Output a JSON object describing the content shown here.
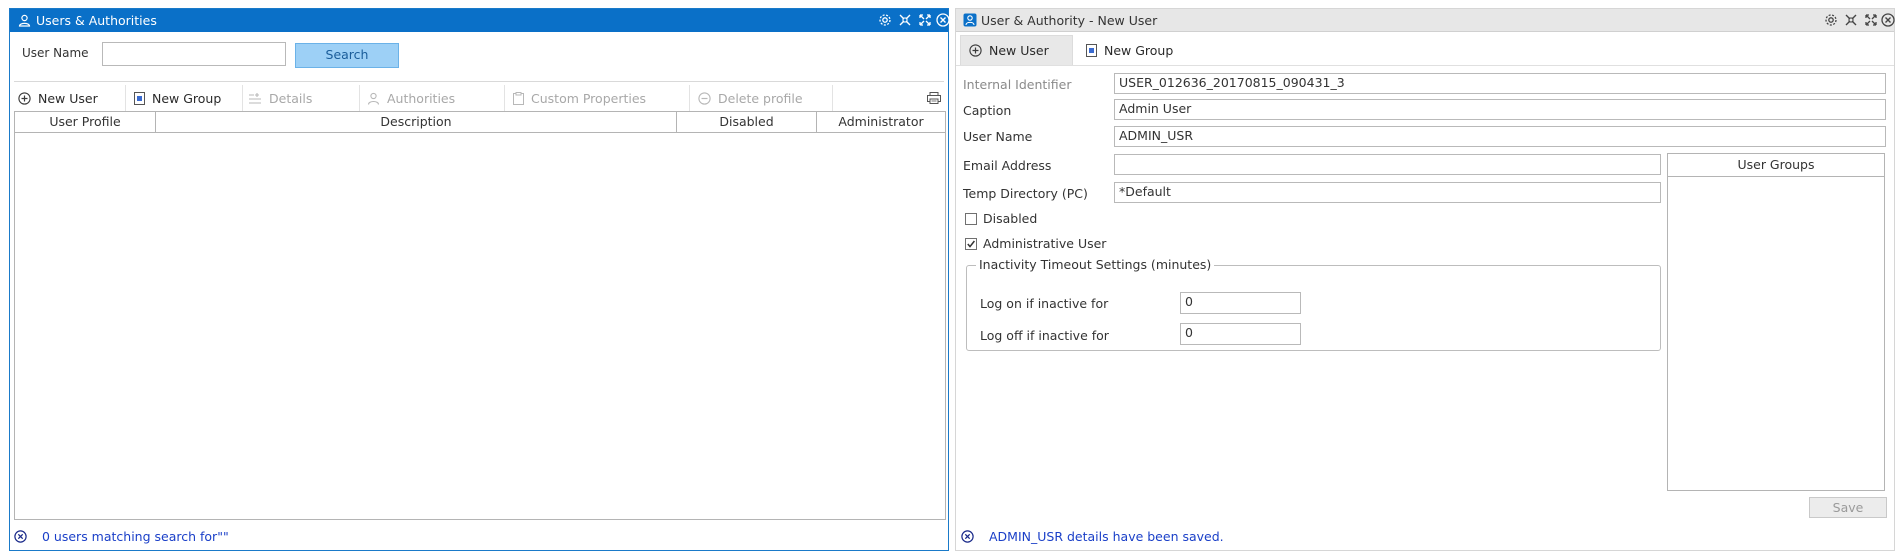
{
  "left_window": {
    "title": "Users & Authorities",
    "search": {
      "label": "User Name",
      "value": "",
      "button_label": "Search"
    },
    "toolbar": {
      "new_user": "New User",
      "new_group": "New Group",
      "details": "Details",
      "authorities": "Authorities",
      "custom_properties": "Custom Properties",
      "delete_profile": "Delete profile"
    },
    "table": {
      "columns": [
        "User Profile",
        "Description",
        "Disabled",
        "Administrator"
      ],
      "rows": []
    },
    "status": "0 users matching search for\"\""
  },
  "right_window": {
    "title": "User & Authority - New User",
    "tabs": [
      "New User",
      "New Group"
    ],
    "form": {
      "internal_identifier": {
        "label": "Internal Identifier",
        "value": "USER_012636_20170815_090431_3"
      },
      "caption": {
        "label": "Caption",
        "value": "Admin User"
      },
      "user_name": {
        "label": "User Name",
        "value": "ADMIN_USR"
      },
      "email": {
        "label": "Email Address",
        "value": ""
      },
      "temp_dir": {
        "label": "Temp Directory (PC)",
        "value": "*Default"
      },
      "disabled": {
        "label": "Disabled",
        "checked": false
      },
      "admin": {
        "label": "Administrative User",
        "checked": true
      },
      "inactivity": {
        "legend": "Inactivity Timeout Settings (minutes)",
        "log_on": {
          "label": "Log on if inactive for",
          "value": "0"
        },
        "log_off": {
          "label": "Log off if inactive for",
          "value": "0"
        }
      }
    },
    "user_groups": {
      "header": "User Groups",
      "items": []
    },
    "save_label": "Save",
    "status": "ADMIN_USR details have been saved."
  },
  "colors": {
    "title_bar_active": "#0a70c8",
    "title_bar_inactive": "#e7e7e7",
    "search_button": "#9dd0f6",
    "status_text": "#1a3fc8"
  },
  "icons": [
    "user-icon",
    "settings-icon",
    "minimize-icon",
    "maximize-icon",
    "close-icon",
    "plus-circle-icon",
    "group-icon",
    "details-icon",
    "person-icon",
    "clipboard-icon",
    "minus-circle-icon",
    "print-icon"
  ]
}
